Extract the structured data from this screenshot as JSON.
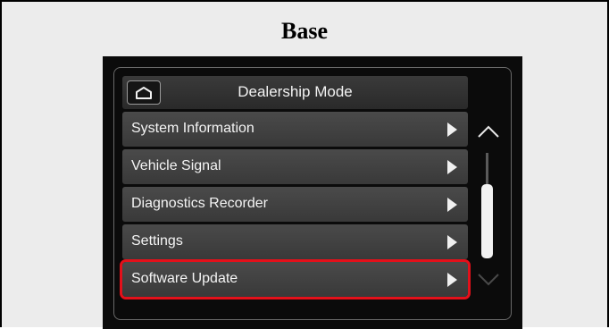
{
  "figure": {
    "title": "Base"
  },
  "screen": {
    "header": {
      "title": "Dealership Mode",
      "home_icon": "home-icon"
    },
    "menu": {
      "items": [
        {
          "label": "System Information",
          "highlighted": false
        },
        {
          "label": "Vehicle Signal",
          "highlighted": false
        },
        {
          "label": "Diagnostics Recorder",
          "highlighted": false
        },
        {
          "label": "Settings",
          "highlighted": false
        },
        {
          "label": "Software Update",
          "highlighted": true
        }
      ]
    },
    "scrollbar": {
      "up_icon": "chevron-up-icon",
      "down_icon": "chevron-down-icon"
    }
  },
  "colors": {
    "highlight": "#e3101a",
    "screen_bg": "#0b0b0b",
    "menu_item_bg": "#424242"
  }
}
